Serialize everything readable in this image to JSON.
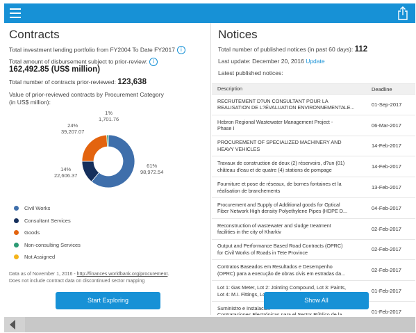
{
  "topbar": {
    "menu_icon": "hamburger-icon",
    "share_icon": "share-icon",
    "color": "#1791d6"
  },
  "contracts": {
    "title": "Contracts",
    "portfolio_label": "Total investment lending portfolio from FY2004 To Date FY2017",
    "prior_review_label": "Total amount of disbursement subject to prior-review:",
    "prior_review_value": "162,492.85 (US$ million)",
    "num_contracts_label": "Total number of contracts prior-reviewed:",
    "num_contracts_value": "123,638",
    "value_label_1": "Value of prior-reviewed contracts by Procurement Category",
    "value_label_2": "(in US$ million):",
    "info_glyph": "i",
    "footnote_prefix": "Data as of November 1, 2016 - ",
    "footnote_link": "http://finances.worldbank.org/procurement",
    "footnote_suffix": ".",
    "footnote_line2": "Does not include contract data on discontinued sector mapping",
    "button": "Start Exploring"
  },
  "chart_data": {
    "type": "pie",
    "donut": true,
    "series": [
      {
        "name": "Civil Works",
        "pct": "61%",
        "value": "98,972.54",
        "share": 0.61,
        "color": "#3f6fab"
      },
      {
        "name": "Consultant Services",
        "pct": "14%",
        "value": "22,606.37",
        "share": 0.14,
        "color": "#152f5c"
      },
      {
        "name": "Goods",
        "pct": "24%",
        "value": "39,207.07",
        "share": 0.24,
        "color": "#e3640f"
      },
      {
        "name": "Non-consulting Services",
        "pct": "1%",
        "value": "1,701.76",
        "share": 0.01,
        "color": "#2b9a73"
      },
      {
        "name": "Not Assigned",
        "pct": "",
        "value": "",
        "share": 0,
        "color": "#f4b41a"
      }
    ]
  },
  "notices": {
    "title": "Notices",
    "published_label": "Total number of published notices (in past 60 days):",
    "published_value": "112",
    "update_label": "Last update: December 20, 2016",
    "update_link": "Update",
    "latest_label": "Latest published notices:",
    "col_description": "Description",
    "col_deadline": "Deadline",
    "rows": [
      {
        "desc1": "RECRUTEMENT D?UN CONSULTANT POUR LA",
        "desc2": "REALISATION DE L?ÉVALUATION ENVIRONNEMENTALE...",
        "deadline": "01-Sep-2017"
      },
      {
        "desc1": "Hebron Regional Wastewater Management Project -",
        "desc2": "Phase I",
        "deadline": "06-Mar-2017"
      },
      {
        "desc1": "PROCUREMENT OF SPECIALIZED MACHINERY AND",
        "desc2": "HEAVY VEHICLES",
        "deadline": "14-Feb-2017"
      },
      {
        "desc1": "Travaux de construction de deux (2) réservoirs, d?un (01)",
        "desc2": "château d'eau et de quatre (4) stations de pompage",
        "deadline": "14-Feb-2017"
      },
      {
        "desc1": "Fourniture et pose de réseaux, de bornes fontaines et la",
        "desc2": "réalisation de branchements",
        "deadline": "13-Feb-2017"
      },
      {
        "desc1": "Procurement and Supply of Additional goods for Optical",
        "desc2": "Fiber Network High density Polyethylene Pipes (HDPE D...",
        "deadline": "04-Feb-2017"
      },
      {
        "desc1": "Reconstruction of wastewater and sludge treatment",
        "desc2": "facilities in the city of Kharkiv",
        "deadline": "02-Feb-2017"
      },
      {
        "desc1": "Output and Performance Based Road Contracts (OPRC)",
        "desc2": "for Civil Works of Roads in Tete Province",
        "deadline": "02-Feb-2017"
      },
      {
        "desc1": "Contratos Baseados em Resultados e Desempenho",
        "desc2": "(OPRC) para a execução de obras civis em estradas da...",
        "deadline": "02-Feb-2017"
      },
      {
        "desc1": "Lot 1: Gas Meter, Lot 2: Jointing Compound, Lot 3: Paints,",
        "desc2": "Lot 4: M.I. Fittings, Lot 5: Pipe Bracket, Lot 6: Wall S...",
        "deadline": "01-Feb-2017"
      },
      {
        "desc1": "Suministro e Instalación",
        "desc2": "Contrataciones Electrónicas para el Sector Público de la...",
        "deadline": "01-Feb-2017"
      }
    ],
    "button": "Show All"
  },
  "bottombar": {
    "back_icon": "back-arrow-icon"
  }
}
